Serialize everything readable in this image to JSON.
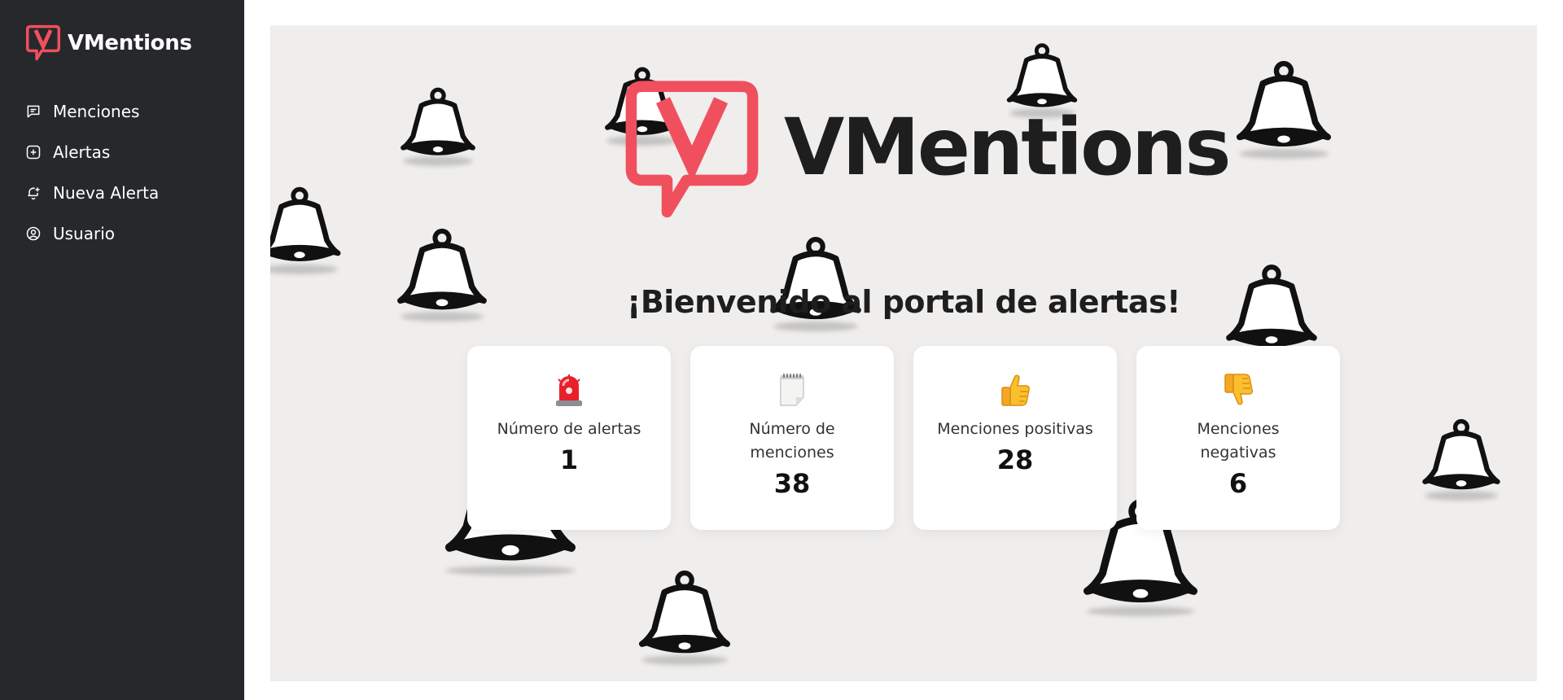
{
  "brand": {
    "name": "VMentions",
    "accent": "#f0505e"
  },
  "sidebar": {
    "items": [
      {
        "label": "Menciones",
        "icon": "message-square-icon"
      },
      {
        "label": "Alertas",
        "icon": "plus-square-icon"
      },
      {
        "label": "Nueva Alerta",
        "icon": "bell-plus-icon"
      },
      {
        "label": "Usuario",
        "icon": "user-circle-icon"
      }
    ]
  },
  "hero": {
    "brand_name": "VMentions",
    "welcome": "¡Bienvenido al portal de alertas!"
  },
  "stats": [
    {
      "label": "Número de alertas",
      "value": "1",
      "icon": "siren-emoji"
    },
    {
      "label": "Número de menciones",
      "value": "38",
      "icon": "notepad-emoji"
    },
    {
      "label": "Menciones positivas",
      "value": "28",
      "icon": "thumbs-up-emoji"
    },
    {
      "label": "Menciones negativas",
      "value": "6",
      "icon": "thumbs-down-emoji"
    }
  ]
}
